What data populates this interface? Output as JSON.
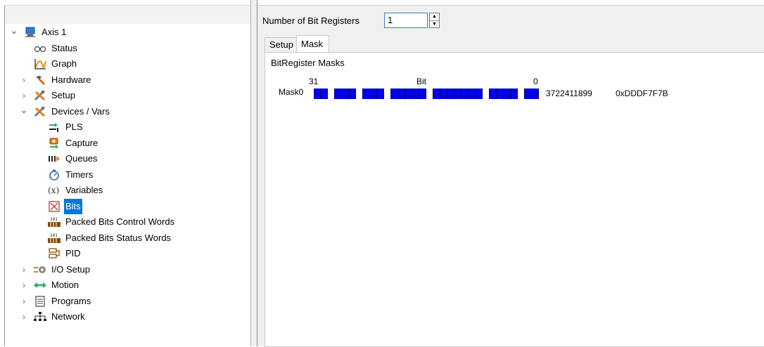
{
  "tree": {
    "items": [
      {
        "label": "Axis 1",
        "chevron": "open",
        "icon": "axis-computer-icon"
      },
      {
        "label": "Status",
        "chevron": "none",
        "icon": "glasses-icon"
      },
      {
        "label": "Graph",
        "chevron": "none",
        "icon": "graph-icon"
      },
      {
        "label": "Hardware",
        "chevron": "closed",
        "icon": "hammer-icon"
      },
      {
        "label": "Setup",
        "chevron": "closed",
        "icon": "tools-icon"
      },
      {
        "label": "Devices / Vars",
        "chevron": "open",
        "icon": "tools-icon"
      },
      {
        "label": "PLS",
        "chevron": "none",
        "icon": "pls-icon"
      },
      {
        "label": "Capture",
        "chevron": "none",
        "icon": "capture-icon"
      },
      {
        "label": "Queues",
        "chevron": "none",
        "icon": "queues-icon"
      },
      {
        "label": "Timers",
        "chevron": "none",
        "icon": "stopwatch-icon"
      },
      {
        "label": "Variables",
        "chevron": "none",
        "icon": "variable-x-icon"
      },
      {
        "label": "Bits",
        "chevron": "none",
        "icon": "bits-box-icon",
        "selected": true
      },
      {
        "label": "Packed Bits Control Words",
        "chevron": "none",
        "icon": "packed-bits-icon"
      },
      {
        "label": "Packed Bits Status Words",
        "chevron": "none",
        "icon": "packed-bits-icon"
      },
      {
        "label": "PID",
        "chevron": "none",
        "icon": "pid-icon"
      },
      {
        "label": "I/O Setup",
        "chevron": "closed",
        "icon": "io-setup-icon"
      },
      {
        "label": "Motion",
        "chevron": "closed",
        "icon": "motion-arrows-icon"
      },
      {
        "label": "Programs",
        "chevron": "closed",
        "icon": "programs-document-icon"
      },
      {
        "label": "Network",
        "chevron": "closed",
        "icon": "network-icon"
      }
    ]
  },
  "toolbar": {
    "num_registers_label": "Number of Bit Registers",
    "num_registers_value": "1",
    "spinner_up": "▲",
    "spinner_down": "▼"
  },
  "tabs": [
    {
      "label": "Setup",
      "active": false
    },
    {
      "label": "Mask",
      "active": true
    }
  ],
  "mask_panel": {
    "heading": "BitRegister Masks",
    "bit_high_label": "31",
    "bit_word_label": "Bit",
    "bit_low_label": "0",
    "masks": [
      {
        "name": "Mask0",
        "decimal": "3722411899",
        "hex": "0xDDDF7F7B",
        "bits_msb_first": [
          1,
          1,
          0,
          1,
          1,
          1,
          0,
          1,
          1,
          1,
          0,
          1,
          1,
          1,
          1,
          1,
          0,
          1,
          1,
          1,
          1,
          1,
          1,
          1,
          0,
          1,
          1,
          1,
          1,
          0,
          1,
          1
        ]
      }
    ],
    "on_color": "#0000e6",
    "off_color": "#ffffff"
  }
}
